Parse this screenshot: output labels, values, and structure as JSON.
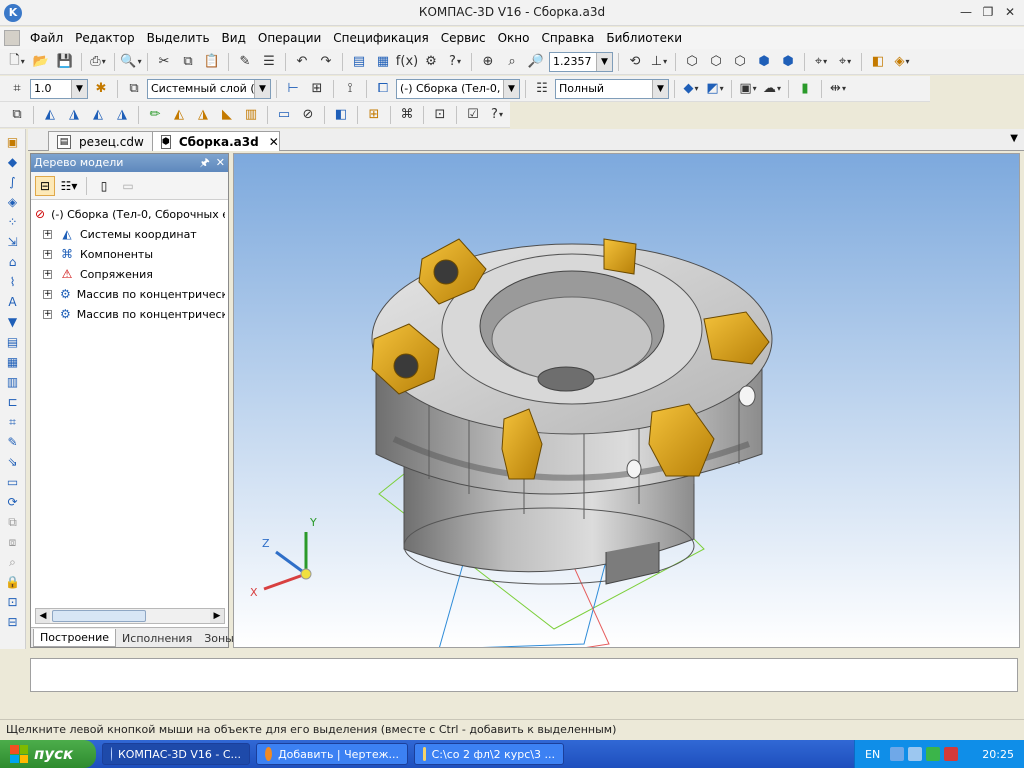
{
  "window": {
    "title": "КОМПАС-3D V16  - Сборка.a3d",
    "app_logo": "K",
    "controls": [
      "—",
      "❐",
      "✕"
    ]
  },
  "menu": [
    "Файл",
    "Редактор",
    "Выделить",
    "Вид",
    "Операции",
    "Спецификация",
    "Сервис",
    "Окно",
    "Справка",
    "Библиотеки"
  ],
  "toolbar": {
    "zoom_value": "1.2357",
    "line_width": "1.0",
    "layer": "Системный слой (0)",
    "component": "(-) Сборка (Тел-0, С",
    "display_mode": "Полный"
  },
  "doc_tabs": [
    {
      "label": "резец.cdw"
    },
    {
      "label": "Сборка.a3d"
    }
  ],
  "tree_panel": {
    "title": "Дерево модели",
    "items": [
      {
        "label": "(-) Сборка (Тел-0, Сборочных е"
      },
      {
        "label": "Системы координат"
      },
      {
        "label": "Компоненты"
      },
      {
        "label": "Сопряжения"
      },
      {
        "label": "Массив по концентрическо"
      },
      {
        "label": "Массив по концентрическо"
      }
    ],
    "tabs": [
      "Построение",
      "Исполнения",
      "Зоны"
    ]
  },
  "axes": {
    "x": "X",
    "y": "Y",
    "z": "Z"
  },
  "status": "Щелкните левой кнопкой мыши на объекте для его выделения (вместе с Ctrl - добавить к выделенным)",
  "taskbar": {
    "start_label": "пуск",
    "tasks": [
      {
        "label": "КОМПАС-3D V16  - С..."
      },
      {
        "label": "Добавить | Чертеж..."
      },
      {
        "label": "C:\\со 2 фл\\2 курс\\3 ..."
      }
    ],
    "language": "EN",
    "clock": "20:25"
  },
  "colors": {
    "accent": "#3a78c8",
    "insert_gold": "#e0a81a",
    "body_gray": "#a8a8a8"
  }
}
